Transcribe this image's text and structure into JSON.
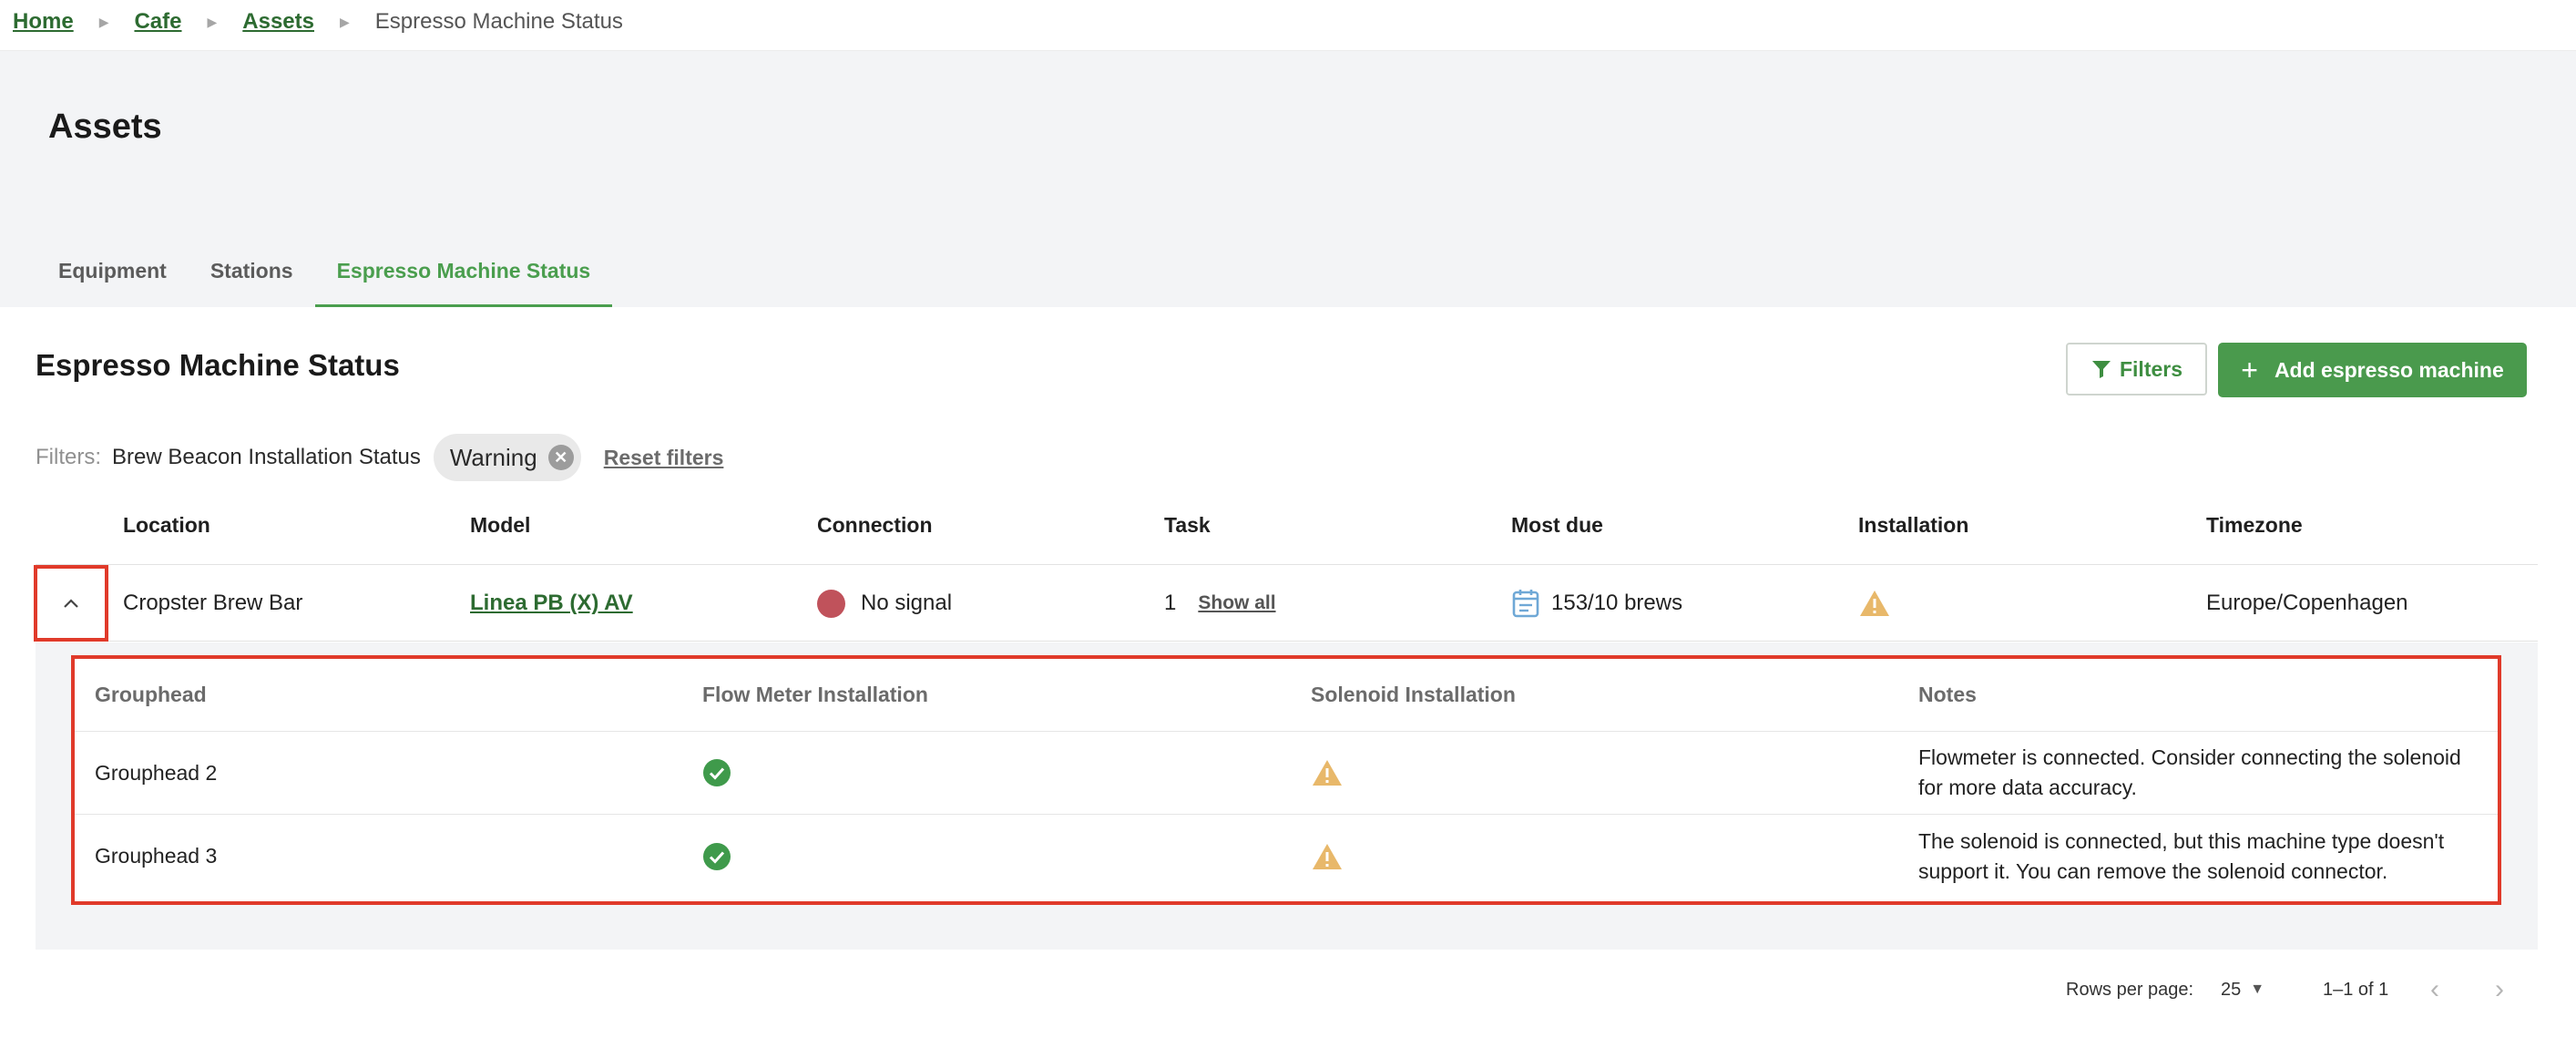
{
  "breadcrumb": {
    "items": [
      "Home",
      "Cafe",
      "Assets"
    ],
    "current": "Espresso Machine Status"
  },
  "header": {
    "title": "Assets",
    "tabs": [
      {
        "label": "Equipment",
        "active": false
      },
      {
        "label": "Stations",
        "active": false
      },
      {
        "label": "Espresso Machine Status",
        "active": true
      }
    ]
  },
  "section": {
    "title": "Espresso Machine Status",
    "filters_button": "Filters",
    "add_button": "Add espresso machine"
  },
  "filters": {
    "label": "Filters:",
    "name": "Brew Beacon Installation Status",
    "chip": "Warning",
    "reset": "Reset filters"
  },
  "table": {
    "columns": [
      "Location",
      "Model",
      "Connection",
      "Task",
      "Most due",
      "Installation",
      "Timezone"
    ],
    "rows": [
      {
        "location": "Cropster Brew Bar",
        "model": "Linea PB (X) AV",
        "connection": "No signal",
        "task_count": "1",
        "task_link": "Show all",
        "most_due": "153/10 brews",
        "installation": "warning",
        "timezone": "Europe/Copenhagen"
      }
    ]
  },
  "subtable": {
    "columns": [
      "Grouphead",
      "Flow Meter Installation",
      "Solenoid Installation",
      "Notes"
    ],
    "rows": [
      {
        "grouphead": "Grouphead 2",
        "flow_meter": "ok",
        "solenoid": "warning",
        "notes_line1": "Flowmeter is connected. Consider connecting the solenoid",
        "notes_line2": "for more data accuracy."
      },
      {
        "grouphead": "Grouphead 3",
        "flow_meter": "ok",
        "solenoid": "warning",
        "notes_line1": "The solenoid is connected, but this machine type doesn't",
        "notes_line2": "support it. You can remove the solenoid connector."
      }
    ]
  },
  "pagination": {
    "rows_label": "Rows per page:",
    "rows_value": "25",
    "range": "1–1 of 1"
  },
  "colors": {
    "accent": "#4a9e4e",
    "link": "#2d6b31",
    "error_dot": "#c0525b",
    "warning": "#e8b86a",
    "ok": "#3f9a4b",
    "highlight": "#e03a2a"
  }
}
